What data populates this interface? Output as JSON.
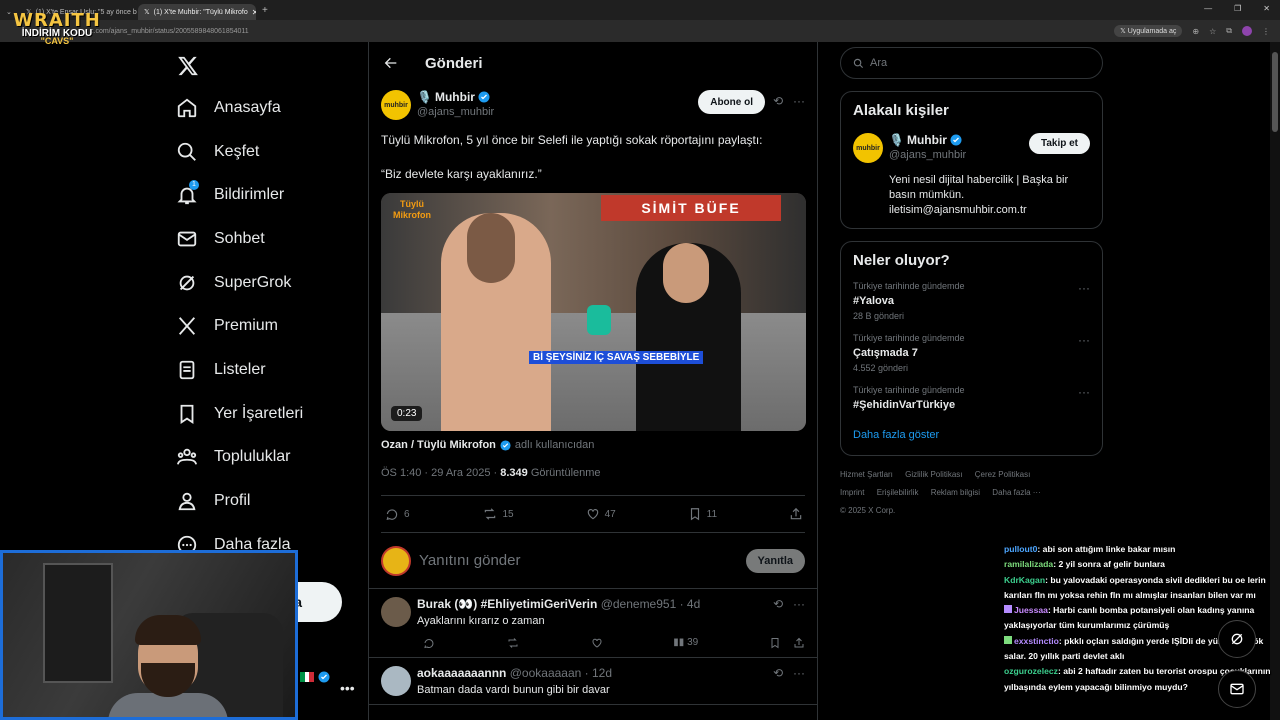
{
  "browser": {
    "tabs": [
      {
        "label": "(1) X'te Ensar Uslu: \"5 ay önce b"
      },
      {
        "label": "(1) X'te Muhbir: \"Tüylü Mikrofo"
      }
    ],
    "url": "x.com/ajans_muhbir/status/2005589848061854011",
    "open_app": "Uygulamada aç"
  },
  "stream_brand": {
    "line1": "WRAITH",
    "line2": "İNDİRİM KODU",
    "line3": "\"CAVS\""
  },
  "nav": {
    "items": [
      {
        "label": "Anasayfa"
      },
      {
        "label": "Keşfet"
      },
      {
        "label": "Bildirimler",
        "badge": "1"
      },
      {
        "label": "Sohbet"
      },
      {
        "label": "SuperGrok"
      },
      {
        "label": "Premium"
      },
      {
        "label": "Listeler"
      },
      {
        "label": "Yer İşaretleri"
      },
      {
        "label": "Topluluklar"
      },
      {
        "label": "Profil"
      },
      {
        "label": "Daha fazla"
      }
    ],
    "post_button": "a"
  },
  "header": {
    "title": "Gönderi"
  },
  "tweet": {
    "author_name": "Muhbir",
    "author_handle": "@ajans_muhbir",
    "avatar_text": "muhbir",
    "follow_label": "Abone ol",
    "text": "Tüylü Mikrofon, 5 yıl önce bir Selefi ile yaptığı sokak röportajını paylaştı:",
    "quote": "“Biz devlete karşı ayaklanırız.”",
    "media": {
      "duration": "0:23",
      "caption": "Bİ ŞEYSİNİZ İÇ SAVAŞ SEBEBİYLE",
      "shop_sign": "SİMİT BÜFE",
      "logo": "Tüylü Mikrofon"
    },
    "attribution_name": "Ozan / Tüylü Mikrofon",
    "attribution_suffix": "adlı kullanıcıdan",
    "timestamp": "ÖS 1:40 · 29 Ara 2025 ·",
    "views": "8.349",
    "views_label": "Görüntülenme",
    "stats": {
      "replies": "6",
      "reposts": "15",
      "likes": "47",
      "bookmarks": "11"
    }
  },
  "reply_box": {
    "placeholder": "Yanıtını gönder",
    "button": "Yanıtla"
  },
  "replies": [
    {
      "name": "Burak (👀) #EhliyetimiGeriVerin",
      "handle": "@deneme951 · 4d",
      "text": "Ayaklarını kırarız o zaman",
      "views": "39"
    },
    {
      "name": "aokaaaaaaannn",
      "handle": "@ookaaaaan · 12d",
      "text": "Batman dada vardı bunun gibi bir davar"
    }
  ],
  "right": {
    "search_placeholder": "Ara",
    "related": {
      "title": "Alakalı kişiler",
      "name": "Muhbir",
      "handle": "@ajans_muhbir",
      "follow": "Takip et",
      "bio": "Yeni nesil dijital habercilik | Başka bir basın mümkün. iletisim@ajansmuhbir.com.tr"
    },
    "trends": {
      "title": "Neler oluyor?",
      "items": [
        {
          "context": "Türkiye tarihinde gündemde",
          "name": "#Yalova",
          "count": "28 B gönderi"
        },
        {
          "context": "Türkiye tarihinde gündemde",
          "name": "Çatışmada 7",
          "count": "4.552 gönderi"
        },
        {
          "context": "Türkiye tarihinde gündemde",
          "name": "#ŞehidinVarTürkiye",
          "count": ""
        }
      ],
      "show_more": "Daha fazla göster"
    },
    "footer": {
      "links": [
        "Hizmet Şartları",
        "Gizlilik Politikası",
        "Çerez Politikası",
        "Imprint",
        "Erişilebilirlik",
        "Reklam bilgisi",
        "Daha fazla ···"
      ],
      "copyright": "© 2025 X Corp."
    }
  },
  "chat": [
    {
      "user": "pullout0",
      "color": "#4da6ff",
      "text": ": abi son attığım linke bakar mısın"
    },
    {
      "user": "ramilalizada",
      "color": "#7ddc7d",
      "text": ": 2 yil sonra af gelir bunlara"
    },
    {
      "user": "KdrKagan",
      "color": "#3ccf8e",
      "text": ": bu yalovadaki operasyonda sivil dedikleri bu oe lerin karıları fln mı yoksa rehin fln mı almışlar insanları bilen var mı"
    },
    {
      "user": "Juessaa",
      "color": "#c98bff",
      "text": ": Harbi canlı bomba potansiyeli olan kadınş yanına yaklaşıyorlar tüm kurumlarımız çürümüş"
    },
    {
      "user": "exxstinctio",
      "color": "#b58cff",
      "text": ": pkklı oçları saldığın yerde IŞİDli de yüz bulur kök salar. 20 yıllık parti devlet aklı"
    },
    {
      "user": "ozgurozelecz",
      "color": "#3ccf8e",
      "text": ": abi 2 haftadır zaten bu terorist orospu çocuklarının yılbaşında eylem yapacağı bilinmiyo muydu?"
    }
  ]
}
